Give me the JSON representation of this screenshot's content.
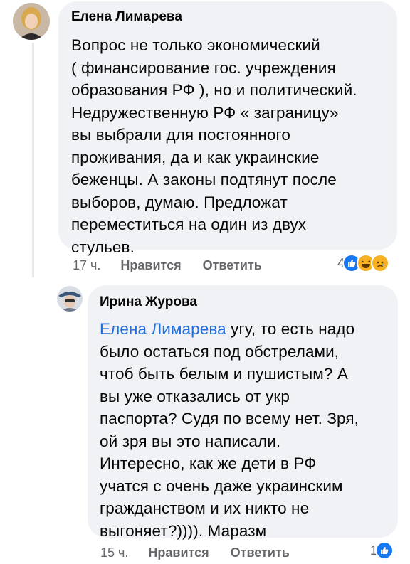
{
  "comments": [
    {
      "author": "Елена Лимарева",
      "text": "Вопрос не только экономический\n( финансирование гос. учреждения\nобразования РФ ), но и политический.\nНедружественную РФ « заграницу»\nвы выбрали для постоянного\nпроживания, да и как украинские\nбеженцы. А законы подтянут после\nвыборов, думаю. Предложат\nпереместиться на один из двух\nстульев.",
      "time": "17 ч.",
      "like_label": "Нравится",
      "reply_label": "Ответить",
      "reaction_count": "4",
      "reactions": [
        "like-icon",
        "haha-icon",
        "sad-icon"
      ]
    },
    {
      "author": "Ирина Журова",
      "mention": "Елена Лимарева",
      "text": " угу, то есть надо\nбыло остаться под обстрелами,\nчтоб быть белым и пушистым? А\nвы уже отказались от укр\nпаспорта? Судя по всему нет. Зря,\nой зря вы это написали.\nИнтересно, как же дети в РФ\nучатся с очень даже украинским\nгражданством и их никто не\nвыгоняет?)))).  Маразм",
      "time": "15 ч.",
      "like_label": "Нравится",
      "reply_label": "Ответить",
      "reaction_count": "1",
      "reactions": [
        "like-icon"
      ]
    }
  ],
  "colors": {
    "bubble": "#f0f2f5",
    "mention": "#216fdb",
    "meta": "#65676b",
    "like": "#1877f2",
    "haha": "#f7b125"
  }
}
